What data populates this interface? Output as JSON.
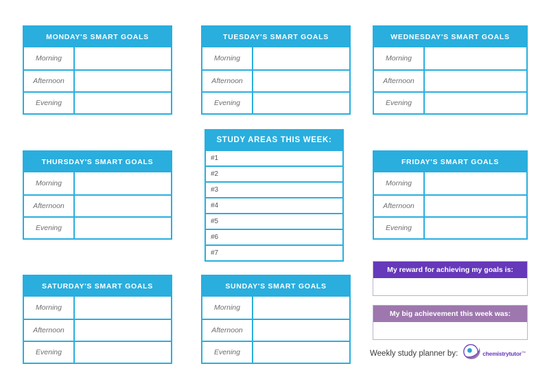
{
  "theme": {
    "accent_cyan": "#29aede",
    "reward_purple_dark": "#6638ba",
    "reward_purple_light": "#9d77ad",
    "label_grey": "#6d6d6d"
  },
  "time_slots": [
    "Morning",
    "Afternoon",
    "Evening"
  ],
  "days": [
    {
      "id": "monday",
      "title": "MONDAY'S SMART GOALS",
      "morning": "",
      "afternoon": "",
      "evening": ""
    },
    {
      "id": "tuesday",
      "title": "TUESDAY'S SMART GOALS",
      "morning": "",
      "afternoon": "",
      "evening": ""
    },
    {
      "id": "wednesday",
      "title": "WEDNESDAY'S SMART GOALS",
      "morning": "",
      "afternoon": "",
      "evening": ""
    },
    {
      "id": "thursday",
      "title": "THURSDAY'S SMART GOALS",
      "morning": "",
      "afternoon": "",
      "evening": ""
    },
    {
      "id": "friday",
      "title": "FRIDAY'S SMART GOALS",
      "morning": "",
      "afternoon": "",
      "evening": ""
    },
    {
      "id": "saturday",
      "title": "SATURDAY'S SMART GOALS",
      "morning": "",
      "afternoon": "",
      "evening": ""
    },
    {
      "id": "sunday",
      "title": "SUNDAY'S SMART GOALS",
      "morning": "",
      "afternoon": "",
      "evening": ""
    }
  ],
  "study_areas": {
    "title": "STUDY AREAS THIS WEEK:",
    "rows": [
      {
        "number": "#1",
        "value": ""
      },
      {
        "number": "#2",
        "value": ""
      },
      {
        "number": "#3",
        "value": ""
      },
      {
        "number": "#4",
        "value": ""
      },
      {
        "number": "#5",
        "value": ""
      },
      {
        "number": "#6",
        "value": ""
      },
      {
        "number": "#7",
        "value": ""
      }
    ]
  },
  "reward": {
    "title": "My reward for achieving my goals is:",
    "value": ""
  },
  "achievement": {
    "title": "My big achievement this week was:",
    "value": ""
  },
  "footer": {
    "credit_text": "Weekly study planner by:",
    "brand_name": "chemistrytutor",
    "brand_tm": "TM"
  }
}
